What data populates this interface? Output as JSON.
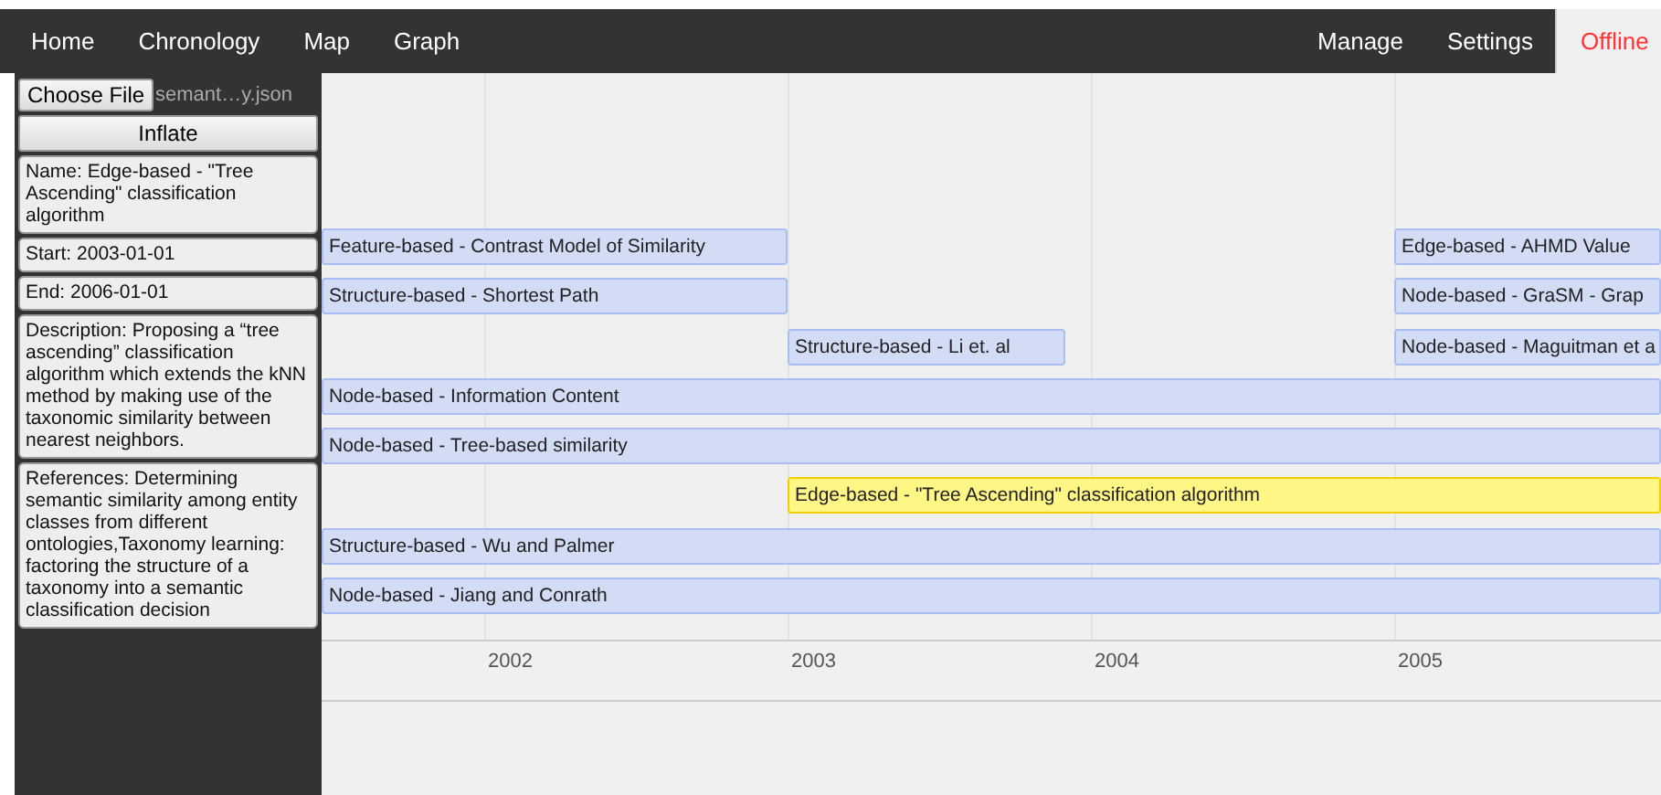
{
  "nav": {
    "left": [
      {
        "label": "Home"
      },
      {
        "label": "Chronology"
      },
      {
        "label": "Map"
      },
      {
        "label": "Graph"
      }
    ],
    "right": [
      {
        "label": "Manage",
        "selected": false
      },
      {
        "label": "Settings",
        "selected": false
      },
      {
        "label": "Offline",
        "selected": true
      }
    ]
  },
  "sidebar": {
    "file_button": "Choose File",
    "file_name": "semant…y.json",
    "inflate_button": "Inflate",
    "details": [
      "Name: Edge-based - \"Tree Ascending\" classification algorithm",
      "Start: 2003-01-01",
      "End: 2006-01-01",
      "Description: Proposing a “tree ascending” classification algorithm which extends the kNN method by making use of the taxonomic similarity between nearest neighbors.",
      "References: Determining semantic similarity among entity classes from different ontologies,Taxonomy learning: factoring the structure of a taxonomy into a semantic classification decision"
    ]
  },
  "timeline": {
    "ticks": [
      {
        "label": "2002"
      },
      {
        "label": "2003"
      },
      {
        "label": "2004"
      },
      {
        "label": "2005"
      }
    ],
    "rows": [
      [
        {
          "label": "Feature-based - Contrast Model of Similarity",
          "selected": false
        },
        {
          "label": "Edge-based - AHMD Value",
          "selected": false
        }
      ],
      [
        {
          "label": "Structure-based - Shortest Path",
          "selected": false
        },
        {
          "label": "Node-based - GraSM - Grap",
          "selected": false
        }
      ],
      [
        {
          "label": "Structure-based - Li et. al",
          "selected": false
        },
        {
          "label": "Node-based - Maguitman et a",
          "selected": false
        }
      ],
      [
        {
          "label": "Node-based - Information Content",
          "selected": false
        }
      ],
      [
        {
          "label": "Node-based - Tree-based similarity",
          "selected": false
        }
      ],
      [
        {
          "label": "Edge-based - \"Tree Ascending\" classification algorithm",
          "selected": true
        }
      ],
      [
        {
          "label": "Structure-based - Wu and Palmer",
          "selected": false
        }
      ],
      [
        {
          "label": "Node-based - Jiang and Conrath",
          "selected": false
        }
      ]
    ]
  }
}
